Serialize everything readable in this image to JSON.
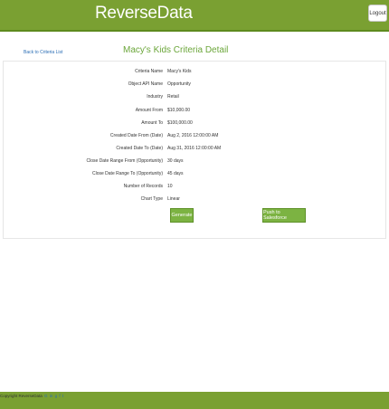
{
  "header": {
    "brand": "ReverseData",
    "logout_label": "Logout"
  },
  "nav": {
    "back_label": "Back to Criteria List"
  },
  "page": {
    "title": "Macy's Kids Criteria Detail"
  },
  "details": [
    {
      "label": "Criteria Name",
      "value": "Macy's Kids"
    },
    {
      "label": "Object API Name",
      "value": "Opportunity"
    },
    {
      "label": "Industry",
      "value": "Retail"
    },
    {
      "label": "Amount From",
      "value": "$10,000.00"
    },
    {
      "label": "Amount To",
      "value": "$100,000.00"
    },
    {
      "label": "Created Date From (Date)",
      "value": "Aug 2, 2016 12:00:00 AM"
    },
    {
      "label": "Created Date To (Date)",
      "value": "Aug 31, 2016 12:00:00 AM"
    },
    {
      "label": "Close Date Range From (Opportunity)",
      "value": "30 days"
    },
    {
      "label": "Close Date Range To (Opportunity)",
      "value": "45 days"
    },
    {
      "label": "Number of Records",
      "value": "10"
    },
    {
      "label": "Chart Type",
      "value": "Linear"
    }
  ],
  "actions": {
    "generate_label": "Generate",
    "push_label": "Push to Salesforce"
  },
  "footer": {
    "copyright": "Copyright ReverseData",
    "social": [
      {
        "glyph": "G",
        "icon": "google-plus-icon"
      },
      {
        "glyph": "in",
        "icon": "linkedin-icon"
      },
      {
        "glyph": "g",
        "icon": "google-icon"
      },
      {
        "glyph": "f",
        "icon": "facebook-icon"
      },
      {
        "glyph": "t",
        "icon": "twitter-icon"
      }
    ]
  },
  "colors": {
    "header_green": "#7aa032",
    "title_green": "#6ba63a",
    "button_green": "#7cb342",
    "link_blue": "#2a6db5"
  }
}
